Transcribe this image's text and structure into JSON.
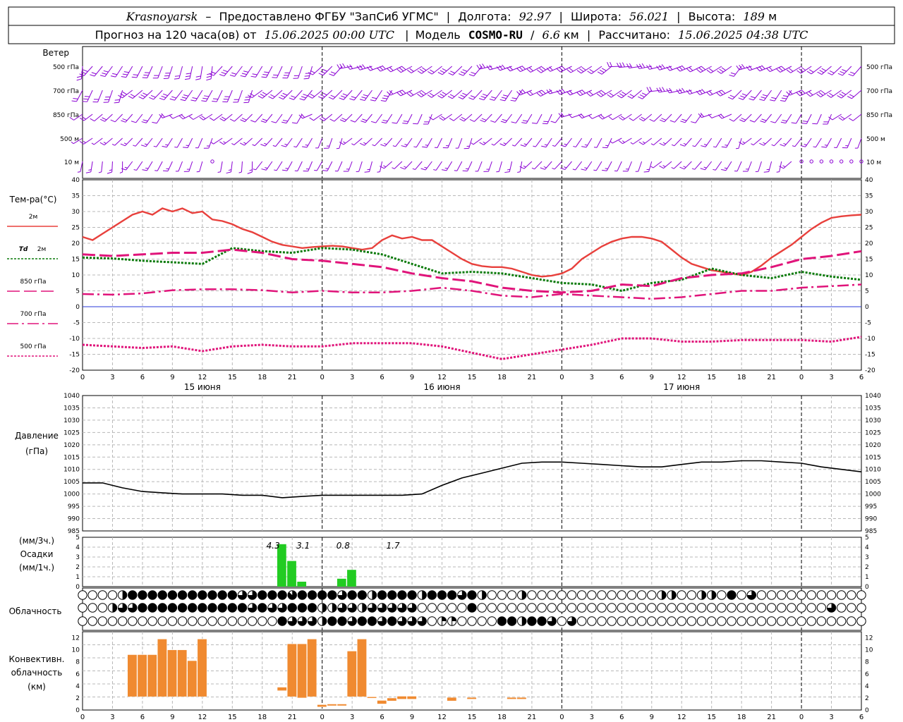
{
  "header": {
    "station": "Krasnoyarsk",
    "dash": "–",
    "provider": "Предоставлено ФГБУ \"ЗапСиб УГМС\"",
    "lon_label": "Долгота:",
    "lon_value": "92.97",
    "lat_label": "Широта:",
    "lat_value": "56.021",
    "alt_label": "Высота:",
    "alt_value": "189",
    "alt_unit": "м",
    "forecast_label": "Прогноз на 120 часа(ов) от",
    "forecast_start": "15.06.2025 00:00 UTC",
    "model_label": "Модель",
    "model_name": "COSMO-RU",
    "model_res": "6.6",
    "model_res_unit": "км",
    "calc_label": "Рассчитано:",
    "calc_time": "15.06.2025 04:38 UTC",
    "sep": "|"
  },
  "wind_panel": {
    "title": "Ветер",
    "levels": [
      "500 гПа",
      "700 гПа",
      "850 гПа",
      "500 м",
      "10 м"
    ],
    "color": "#8a00d4"
  },
  "time_axis": {
    "hour_ticks": [
      "0",
      "3",
      "6",
      "9",
      "12",
      "15",
      "18",
      "21",
      "0",
      "3",
      "6",
      "9",
      "12",
      "15",
      "18",
      "21",
      "0",
      "3",
      "6",
      "9",
      "12",
      "15",
      "18",
      "21",
      "0",
      "3",
      "6"
    ],
    "day_labels": [
      "15 июня",
      "16 июня",
      "17 июня"
    ]
  },
  "colors": {
    "t2m": "#e8403c",
    "td2m": "#0a7a0a",
    "t850": "#e0147a",
    "pressure": "#000000",
    "precip": "#22cc22",
    "convective": "#f08a30",
    "zero_line": "#2a3ad8"
  },
  "temperature_panel": {
    "title": "Тем-ра(°С)",
    "legend": [
      {
        "key": "t2m",
        "label": "2м"
      },
      {
        "key": "td2m",
        "prefix": "Td",
        "label": "2м"
      },
      {
        "key": "t850",
        "label": "850 гПа"
      },
      {
        "key": "t700",
        "label": "700 гПа"
      },
      {
        "key": "t500",
        "label": "500 гПа"
      }
    ],
    "y_ticks": [
      "40",
      "35",
      "30",
      "25",
      "20",
      "15",
      "10",
      "5",
      "0",
      "-5",
      "-10",
      "-15",
      "-20"
    ]
  },
  "pressure_panel": {
    "title": "Давление",
    "unit": "(гПа)",
    "y_ticks": [
      "1040",
      "1035",
      "1030",
      "1025",
      "1020",
      "1015",
      "1010",
      "1005",
      "1000",
      "995",
      "990",
      "985"
    ]
  },
  "precip_panel": {
    "unit3": "(мм/3ч.)",
    "title": "Осадки",
    "unit1": "(мм/1ч.)",
    "y_ticks": [
      "5",
      "4",
      "3",
      "2",
      "1",
      "0"
    ],
    "value_labels": [
      "4.3",
      "3.1",
      "0.8",
      "1.7"
    ]
  },
  "cloud_panel": {
    "title": "Облачность"
  },
  "convective_panel": {
    "title1": "Конвективн.",
    "title2": "облачность",
    "unit": "(км)",
    "y_ticks": [
      "12",
      "10",
      "8",
      "6",
      "4",
      "2",
      "0"
    ]
  },
  "chart_data": {
    "type": "line",
    "x_unit": "hours since 15.06.2025 00:00 UTC",
    "x_range": [
      0,
      78
    ],
    "wind_barbs": {
      "levels": [
        "500 гПа",
        "700 гПа",
        "850 гПа",
        "500 м",
        "10 м"
      ]
    },
    "temperature": {
      "ylim": [
        -20,
        40
      ],
      "series": [
        {
          "name": "2м",
          "key": "t2m",
          "x": [
            0,
            1,
            2,
            3,
            4,
            5,
            6,
            7,
            8,
            9,
            10,
            11,
            12,
            13,
            14,
            15,
            16,
            17,
            18,
            19,
            20,
            21,
            22,
            23,
            24,
            25,
            26,
            27,
            28,
            29,
            30,
            31,
            32,
            33,
            34,
            35,
            36,
            37,
            38,
            39,
            40,
            41,
            42,
            43,
            44,
            45,
            46,
            47,
            48,
            49,
            50,
            51,
            52,
            53,
            54,
            55,
            56,
            57,
            58,
            59,
            60,
            61,
            62,
            63,
            64,
            65,
            66,
            67,
            68,
            69,
            70,
            71,
            72,
            73,
            74,
            75,
            76,
            77,
            78
          ],
          "y": [
            22,
            21,
            23,
            25,
            27,
            29,
            30,
            29,
            31,
            30,
            31,
            29.5,
            30,
            27.5,
            27,
            26,
            24.5,
            23.5,
            22,
            20.5,
            19.5,
            19,
            18.5,
            18.8,
            19,
            19.2,
            19,
            18.5,
            18,
            18.5,
            21,
            22.5,
            21.5,
            22,
            21,
            21,
            19,
            17,
            15,
            13.5,
            12.8,
            12.5,
            12.5,
            12,
            11,
            10,
            9.5,
            9.8,
            10.5,
            12,
            15,
            17,
            19,
            20.5,
            21.5,
            22,
            22,
            21.5,
            20.5,
            18,
            15.5,
            13.5,
            12.5,
            11.5,
            11,
            10.5,
            10,
            11,
            13,
            15.5,
            17.5,
            19.5,
            22,
            24.5,
            26.5,
            28,
            28.5,
            28.8,
            29
          ]
        },
        {
          "name": "Td 2м",
          "key": "td2m",
          "x": [
            0,
            3,
            6,
            9,
            12,
            15,
            18,
            21,
            24,
            27,
            30,
            33,
            36,
            39,
            42,
            45,
            48,
            51,
            54,
            57,
            60,
            63,
            66,
            69,
            72,
            75,
            78
          ],
          "y": [
            15.5,
            15.2,
            14.5,
            14,
            13.5,
            18.5,
            17.5,
            17,
            18.5,
            18,
            16.5,
            13.5,
            10.5,
            11,
            10.5,
            9,
            7.5,
            7,
            5,
            7.5,
            8.5,
            12,
            10,
            9,
            11,
            9.5,
            8.5
          ]
        },
        {
          "name": "850 гПа",
          "key": "t850",
          "x": [
            0,
            3,
            6,
            9,
            12,
            15,
            18,
            21,
            24,
            27,
            30,
            33,
            36,
            39,
            42,
            45,
            48,
            51,
            54,
            57,
            60,
            63,
            66,
            69,
            72,
            75,
            78
          ],
          "y": [
            16.5,
            16,
            16.5,
            17,
            17,
            18,
            17,
            15,
            14.5,
            13.5,
            12.5,
            10.5,
            9,
            8,
            6,
            5,
            4.5,
            5,
            7,
            6.5,
            9,
            10,
            10.5,
            12.5,
            15,
            16,
            17.5
          ]
        },
        {
          "name": "700 гПа",
          "key": "t700",
          "x": [
            0,
            3,
            6,
            9,
            12,
            15,
            18,
            21,
            24,
            27,
            30,
            33,
            36,
            39,
            42,
            45,
            48,
            51,
            54,
            57,
            60,
            63,
            66,
            69,
            72,
            75,
            78
          ],
          "y": [
            4,
            3.8,
            4.2,
            5.2,
            5.5,
            5.5,
            5.2,
            4.5,
            5,
            4.5,
            4.5,
            5,
            6,
            5,
            3.5,
            3,
            4,
            3.5,
            3,
            2.5,
            3,
            4,
            5,
            5,
            6,
            6.5,
            7
          ]
        },
        {
          "name": "500 гПа",
          "key": "t500",
          "x": [
            0,
            3,
            6,
            9,
            12,
            15,
            18,
            21,
            24,
            27,
            30,
            33,
            36,
            39,
            42,
            45,
            48,
            51,
            54,
            57,
            60,
            63,
            66,
            69,
            72,
            75,
            78
          ],
          "y": [
            -12,
            -12.5,
            -13,
            -12.5,
            -14,
            -12.5,
            -12,
            -12.5,
            -12.5,
            -11.5,
            -11.5,
            -11.5,
            -12.5,
            -14.5,
            -16.5,
            -15,
            -13.5,
            -12,
            -10,
            -10,
            -11,
            -11,
            -10.5,
            -10.5,
            -10.5,
            -11,
            -9.5
          ]
        }
      ]
    },
    "pressure": {
      "ylim": [
        985,
        1040
      ],
      "x": [
        0,
        2,
        4,
        6,
        8,
        10,
        12,
        14,
        16,
        18,
        20,
        22,
        24,
        26,
        28,
        30,
        32,
        34,
        36,
        38,
        40,
        42,
        44,
        46,
        48,
        50,
        52,
        54,
        56,
        58,
        60,
        62,
        64,
        66,
        68,
        70,
        72,
        74,
        76,
        78
      ],
      "y": [
        1004.5,
        1004.5,
        1002.5,
        1001,
        1000.5,
        1000,
        1000,
        1000,
        999.5,
        999.5,
        998.5,
        999,
        999.5,
        999.5,
        999.5,
        999.5,
        999.5,
        1000,
        1003.5,
        1006.5,
        1008.5,
        1010.5,
        1012.5,
        1013,
        1013,
        1012.5,
        1012,
        1011.5,
        1011,
        1011,
        1012,
        1013,
        1013,
        1013.5,
        1013.5,
        1013,
        1012.5,
        1011,
        1010,
        1009
      ]
    },
    "precipitation": {
      "ylim": [
        0,
        5
      ],
      "x": [
        20,
        21,
        22,
        26,
        27
      ],
      "values": [
        4.3,
        2.6,
        0.5,
        0.8,
        1.7
      ],
      "labelled_totals": [
        4.3,
        3.1,
        0.8,
        1.7
      ]
    },
    "cloud_rows": {
      "upper": [
        0,
        0,
        0,
        0,
        4,
        8,
        8,
        8,
        8,
        8,
        8,
        8,
        8,
        8,
        8,
        8,
        6,
        6,
        8,
        8,
        8,
        7,
        8,
        8,
        8,
        8,
        6,
        8,
        8,
        4,
        8,
        8,
        8,
        8,
        4,
        8,
        8,
        8,
        6,
        8,
        4,
        0,
        0,
        0,
        4,
        0,
        0,
        0,
        0,
        0,
        0,
        0,
        0,
        0,
        0,
        0,
        0,
        0,
        4,
        4,
        0,
        0,
        4,
        4,
        0,
        8,
        0,
        6,
        0,
        0,
        0,
        0,
        0,
        0,
        0,
        0,
        0,
        0,
        0
      ],
      "middle": [
        0,
        0,
        0,
        4,
        6,
        6,
        8,
        8,
        8,
        8,
        8,
        8,
        8,
        8,
        8,
        8,
        8,
        6,
        8,
        6,
        6,
        8,
        8,
        8,
        4,
        4,
        6,
        6,
        4,
        6,
        6,
        6,
        6,
        6,
        0,
        0,
        0,
        0,
        0,
        8,
        0,
        0,
        0,
        0,
        0,
        0,
        0,
        0,
        0,
        0,
        0,
        0,
        0,
        0,
        0,
        0,
        0,
        0,
        0,
        0,
        0,
        0,
        0,
        0,
        0,
        0,
        0,
        0,
        0,
        0,
        0,
        0,
        0,
        0,
        0,
        6,
        0,
        0,
        0
      ],
      "lower": [
        0,
        0,
        0,
        0,
        0,
        0,
        0,
        0,
        0,
        0,
        0,
        0,
        0,
        0,
        0,
        0,
        0,
        0,
        0,
        0,
        8,
        6,
        6,
        6,
        4,
        8,
        8,
        6,
        8,
        8,
        6,
        8,
        6,
        6,
        6,
        0,
        2,
        2,
        0,
        0,
        0,
        0,
        8,
        8,
        4,
        8,
        8,
        6,
        0,
        6,
        0,
        0,
        0,
        0,
        0,
        0,
        0,
        0,
        0,
        0,
        0,
        0,
        0,
        0,
        0,
        0,
        0,
        0,
        0,
        0,
        0,
        0,
        0,
        0,
        0,
        0,
        0,
        0,
        0
      ]
    },
    "convective": {
      "ylim": [
        0,
        13
      ],
      "bars": [
        {
          "x": 5,
          "base": 2.2,
          "top": 9.2
        },
        {
          "x": 6,
          "base": 2.2,
          "top": 9.2
        },
        {
          "x": 7,
          "base": 2.2,
          "top": 9.2
        },
        {
          "x": 8,
          "base": 2.2,
          "top": 11.8
        },
        {
          "x": 9,
          "base": 2.2,
          "top": 10
        },
        {
          "x": 10,
          "base": 2.2,
          "top": 10
        },
        {
          "x": 11,
          "base": 2.2,
          "top": 8.2
        },
        {
          "x": 12,
          "base": 2.2,
          "top": 11.8
        },
        {
          "x": 20,
          "base": 3.2,
          "top": 3.8
        },
        {
          "x": 21,
          "base": 2.2,
          "top": 11
        },
        {
          "x": 22,
          "base": 2,
          "top": 11
        },
        {
          "x": 23,
          "base": 2.2,
          "top": 11.8
        },
        {
          "x": 24,
          "base": 0.5,
          "top": 0.9
        },
        {
          "x": 25,
          "base": 0.7,
          "top": 1
        },
        {
          "x": 26,
          "base": 0.7,
          "top": 1
        },
        {
          "x": 27,
          "base": 2.2,
          "top": 9.8
        },
        {
          "x": 28,
          "base": 2.2,
          "top": 11.8
        },
        {
          "x": 29,
          "base": 2,
          "top": 2.2
        },
        {
          "x": 30,
          "base": 1,
          "top": 1.6
        },
        {
          "x": 31,
          "base": 1.5,
          "top": 2
        },
        {
          "x": 32,
          "base": 1.8,
          "top": 2.3
        },
        {
          "x": 33,
          "base": 1.8,
          "top": 2.3
        },
        {
          "x": 37,
          "base": 1.5,
          "top": 2.1
        },
        {
          "x": 39,
          "base": 1.8,
          "top": 2.1
        },
        {
          "x": 43,
          "base": 1.8,
          "top": 2.1
        },
        {
          "x": 44,
          "base": 1.8,
          "top": 2.1
        }
      ]
    }
  }
}
